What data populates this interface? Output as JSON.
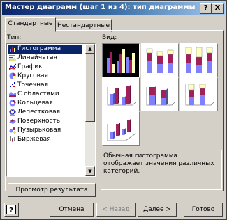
{
  "window": {
    "title": "Мастер диаграмм (шаг 1 из 4): тип диаграммы"
  },
  "titlebar_buttons": {
    "help": "?",
    "close": "X"
  },
  "tabs": [
    {
      "label": "Стандартные"
    },
    {
      "label": "Нестандартные"
    }
  ],
  "type_list": {
    "label": "Тип:",
    "items": [
      {
        "label": "Гистограмма",
        "icon": "histogram-icon"
      },
      {
        "label": "Линейчатая",
        "icon": "bar-chart-icon"
      },
      {
        "label": "График",
        "icon": "line-chart-icon"
      },
      {
        "label": "Круговая",
        "icon": "pie-chart-icon"
      },
      {
        "label": "Точечная",
        "icon": "scatter-chart-icon"
      },
      {
        "label": "С областями",
        "icon": "area-chart-icon"
      },
      {
        "label": "Кольцевая",
        "icon": "doughnut-chart-icon"
      },
      {
        "label": "Лепестковая",
        "icon": "radar-chart-icon"
      },
      {
        "label": "Поверхность",
        "icon": "surface-chart-icon"
      },
      {
        "label": "Пузырьковая",
        "icon": "bubble-chart-icon"
      },
      {
        "label": "Биржевая",
        "icon": "stock-chart-icon"
      }
    ]
  },
  "view": {
    "label": "Вид:"
  },
  "description": "Обычная гистограмма отображает значения различных категорий.",
  "preview_button": "Просмотр результата",
  "buttons": {
    "help_icon": "help-icon",
    "cancel": "Отмена",
    "back": "< Назад",
    "next": "Далее >",
    "finish": "Готово"
  },
  "colors": {
    "title_bar": "#0a246a",
    "selection": "#0a246a",
    "bar_blue": "#8080ff",
    "bar_red": "#a0205a",
    "bar_yellow": "#ffffc0"
  }
}
